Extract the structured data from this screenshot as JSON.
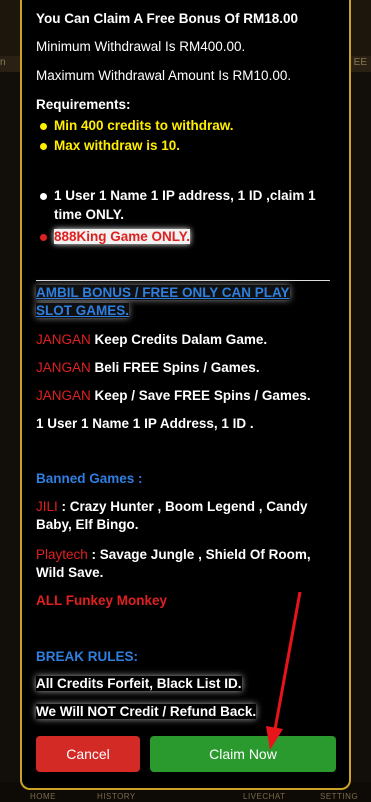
{
  "dialog": {
    "line1": "You Can Claim A Free Bonus Of RM18.00",
    "line2": "Minimum Withdrawal Is RM400.00.",
    "line3": "Maximum Withdrawal Amount Is RM10.00.",
    "req_title": "Requirements:",
    "req1": "Min 400 credits to withdraw.",
    "req2": "Max withdraw is 10.",
    "rule1a": "1 User 1 Name 1 IP address, 1 ID ,claim 1",
    "rule1b": "time ONLY.",
    "rule2": "888King Game ONLY.",
    "ambil1": "AMBIL BONUS / FREE ONLY CAN PLAY",
    "ambil2": "SLOT GAMES.",
    "jangan": "JANGAN",
    "j1": " Keep Credits Dalam Game.",
    "j2": " Beli FREE Spins / Games.",
    "j3": " Keep / Save FREE Spins / Games.",
    "one_user": "1 User 1 Name 1 IP Address, 1 ID .",
    "banned_title": "Banned Games :",
    "jili": "JILI",
    "jili_games1": " : Crazy Hunter , Boom Legend , Candy",
    "jili_games2": "Baby, Elf Bingo.",
    "playtech": "Playtech",
    "playtech_games1": " : Savage Jungle , Shield Of Room,",
    "playtech_games2": "Wild Save.",
    "funkey": "ALL Funkey Monkey",
    "break_title": "BREAK RULES:",
    "forfeit": "All Credits Forfeit, Black List ID.",
    "no_credit": "We Will NOT Credit / Refund Back.",
    "cancel_label": "Cancel",
    "claim_label": "Claim Now"
  },
  "background": {
    "strip_left": "n",
    "strip_right": "EE",
    "nav": [
      "HOME",
      "HISTORY",
      "LIVECHAT",
      "SETTING"
    ]
  },
  "colors": {
    "border": "#c9a227",
    "yellow_text": "#ffee00",
    "red_text": "#e02020",
    "blue_text": "#2f7fe0",
    "cancel_button": "#d42a26",
    "claim_button": "#2b9a2e"
  }
}
